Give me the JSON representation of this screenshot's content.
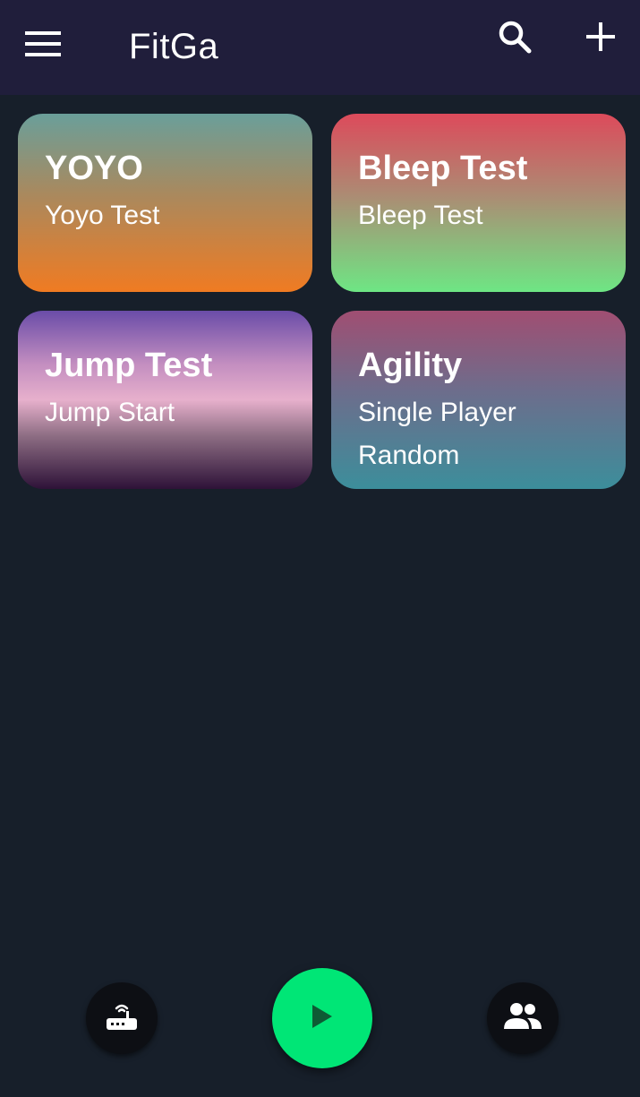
{
  "appbar": {
    "title": "FitGa",
    "menu_icon": "menu-icon",
    "search_icon": "search-icon",
    "add_icon": "plus-icon",
    "background": "#201e3b"
  },
  "cards": [
    {
      "title": "YOYO",
      "lines": [
        "Yoyo Test"
      ]
    },
    {
      "title": "Bleep Test",
      "lines": [
        "Bleep Test"
      ]
    },
    {
      "title": "Jump Test",
      "lines": [
        "Jump Start"
      ]
    },
    {
      "title": "Agility",
      "lines": [
        "Single Player",
        "Random"
      ]
    }
  ],
  "bottom_bar": {
    "left_icon": "router-icon",
    "center_icon": "play-icon",
    "right_icon": "people-icon",
    "play_color": "#00e676"
  },
  "colors": {
    "background": "#171f2a"
  }
}
